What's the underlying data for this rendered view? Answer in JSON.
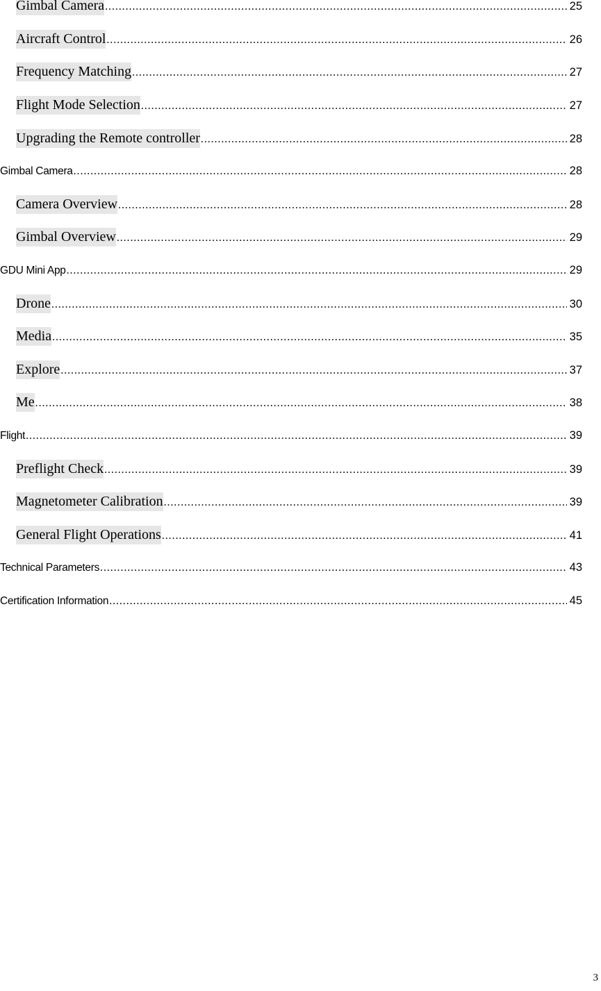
{
  "toc": {
    "entries": [
      {
        "title": "Gimbal Camera",
        "page": "25",
        "level": 2
      },
      {
        "title": "Aircraft Control",
        "page": "26",
        "level": 2
      },
      {
        "title": "Frequency Matching",
        "page": "27",
        "level": 2
      },
      {
        "title": "Flight Mode Selection",
        "page": "27",
        "level": 2
      },
      {
        "title": "Upgrading the Remote controller",
        "page": "28",
        "level": 2
      },
      {
        "title": "Gimbal Camera",
        "page": "28",
        "level": 1
      },
      {
        "title": "Camera Overview",
        "page": "28",
        "level": 2
      },
      {
        "title": "Gimbal Overview",
        "page": "29",
        "level": 2
      },
      {
        "title": "GDU Mini App",
        "page": "29",
        "level": 1
      },
      {
        "title": "Drone",
        "page": "30",
        "level": 2
      },
      {
        "title": "Media",
        "page": "35",
        "level": 2
      },
      {
        "title": "Explore",
        "page": "37",
        "level": 2
      },
      {
        "title": "Me",
        "page": "38",
        "level": 2
      },
      {
        "title": "Flight",
        "page": "39",
        "level": 1
      },
      {
        "title": "Preflight Check",
        "page": "39",
        "level": 2
      },
      {
        "title": "Magnetometer Calibration",
        "page": "39",
        "level": 2
      },
      {
        "title": "General Flight Operations",
        "page": "41",
        "level": 2
      },
      {
        "title": "Technical Parameters",
        "page": "43",
        "level": 1
      },
      {
        "title": "Certification Information",
        "page": "45",
        "level": 1
      }
    ]
  },
  "footer": {
    "page_number": "3"
  },
  "colors": {
    "field_highlight": "#e6e6e6",
    "text": "#000000"
  }
}
